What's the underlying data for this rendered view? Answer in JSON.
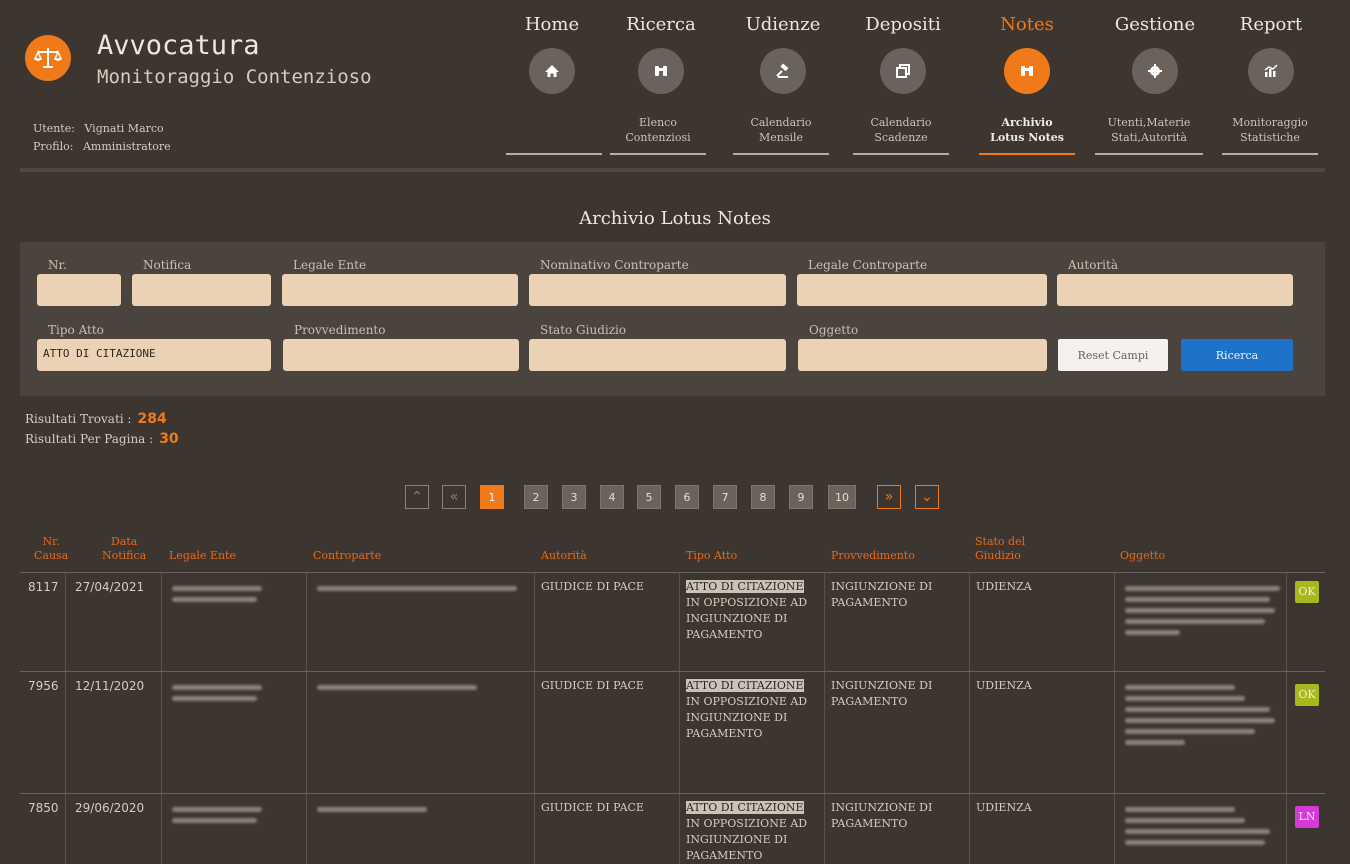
{
  "app": {
    "title": "Avvocatura",
    "subtitle": "Monitoraggio Contenzioso"
  },
  "user": {
    "label": "Utente:",
    "name": "Vignati Marco",
    "profile_label": "Profilo:",
    "profile": "Amministratore"
  },
  "nav": [
    {
      "label": "Home",
      "icon": "home-icon",
      "sub": []
    },
    {
      "label": "Ricerca",
      "icon": "binoculars-icon",
      "sub": [
        "Elenco",
        "Contenziosi"
      ]
    },
    {
      "label": "Udienze",
      "icon": "gavel-icon",
      "sub": [
        "Calendario",
        "Mensile"
      ]
    },
    {
      "label": "Depositi",
      "icon": "copy-icon",
      "sub": [
        "Calendario",
        "Scadenze"
      ]
    },
    {
      "label": "Notes",
      "icon": "binoculars-icon",
      "sub": [
        "Archivio",
        "Lotus Notes"
      ],
      "active": true
    },
    {
      "label": "Gestione",
      "icon": "gear-icon",
      "sub": [
        "Utenti,Materie",
        "Stati,Autorità"
      ]
    },
    {
      "label": "Report",
      "icon": "chart-icon",
      "sub": [
        "Monitoraggio",
        "Statistiche"
      ]
    }
  ],
  "page_title": "Archivio Lotus Notes",
  "form": {
    "nr": {
      "label": "Nr.",
      "value": ""
    },
    "notifica": {
      "label": "Notifica",
      "value": ""
    },
    "legale_ente": {
      "label": "Legale Ente",
      "value": ""
    },
    "nominativo": {
      "label": "Nominativo Controparte",
      "value": ""
    },
    "legale_controparte": {
      "label": "Legale Controparte",
      "value": ""
    },
    "autorita": {
      "label": "Autorità",
      "value": ""
    },
    "tipo_atto": {
      "label": "Tipo Atto",
      "value": "ATTO DI CITAZIONE"
    },
    "provvedimento": {
      "label": "Provvedimento",
      "value": ""
    },
    "stato_giudizio": {
      "label": "Stato Giudizio",
      "value": ""
    },
    "oggetto": {
      "label": "Oggetto",
      "value": ""
    },
    "reset_label": "Reset Campi",
    "search_label": "Ricerca"
  },
  "results": {
    "found_label": "Risultati Trovati :",
    "found": "284",
    "per_page_label": "Risultati Per Pagina :",
    "per_page": "30"
  },
  "pagination": {
    "pages": [
      "1",
      "2",
      "3",
      "4",
      "5",
      "6",
      "7",
      "8",
      "9",
      "10"
    ],
    "current": "1"
  },
  "table": {
    "headers": {
      "nr": [
        "Nr.",
        "Causa"
      ],
      "data": [
        "Data",
        "Notifica"
      ],
      "legale": "Legale Ente",
      "controparte": "Controparte",
      "autorita": "Autorità",
      "tipo": "Tipo Atto",
      "provvedimento": "Provvedimento",
      "stato": [
        "Stato del",
        "Giudizio"
      ],
      "oggetto": "Oggetto"
    },
    "rows": [
      {
        "nr": "8117",
        "data": "27/04/2021",
        "autorita": "GIUDICE DI PACE",
        "tipo_hl": "ATTO DI CITAZIONE",
        "tipo_rest": "IN OPPOSIZIONE AD INGIUNZIONE DI PAGAMENTO",
        "provvedimento": "INGIUNZIONE DI PAGAMENTO",
        "stato": "UDIENZA",
        "badge": "OK"
      },
      {
        "nr": "7956",
        "data": "12/11/2020",
        "autorita": "GIUDICE DI PACE",
        "tipo_hl": "ATTO DI CITAZIONE",
        "tipo_rest": "IN OPPOSIZIONE AD INGIUNZIONE DI PAGAMENTO",
        "provvedimento": "INGIUNZIONE DI PAGAMENTO",
        "stato": "UDIENZA",
        "badge": "OK"
      },
      {
        "nr": "7850",
        "data": "29/06/2020",
        "autorita": "GIUDICE DI PACE",
        "tipo_hl": "ATTO DI CITAZIONE",
        "tipo_rest": "IN OPPOSIZIONE AD INGIUNZIONE DI PAGAMENTO",
        "provvedimento": "INGIUNZIONE DI PAGAMENTO",
        "stato": "UDIENZA",
        "badge": "LN"
      }
    ]
  },
  "colors": {
    "accent": "#f07a1a",
    "background": "#3d3530",
    "panel": "#4b433d",
    "input": "#ecd2b4",
    "search_button": "#1e73c8",
    "badge_ok": "#a8b81d",
    "badge_ln": "#d63ad6"
  }
}
